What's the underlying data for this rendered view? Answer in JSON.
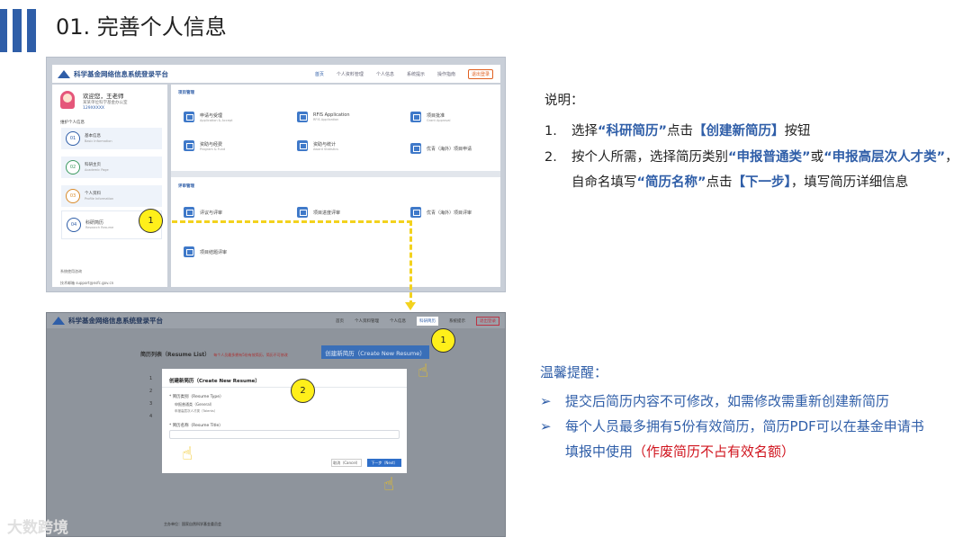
{
  "slide": {
    "title": "01. 完善个人信息"
  },
  "shot1": {
    "platform": "科学基金网络信息系统登录平台",
    "nav": [
      "首页",
      "个人资料管理",
      "个人信息",
      "系统提示",
      "操作指南"
    ],
    "logout": "退出登录",
    "welcome": "欢迎您，王老师",
    "org": "某某单位科学基金办公室",
    "id": "129XXXXX",
    "section": "维护个人信息",
    "menu": [
      {
        "num": "01",
        "label": "基本信息",
        "sub": "Basic Information"
      },
      {
        "num": "02",
        "label": "科研主页",
        "sub": "Academic Page"
      },
      {
        "num": "03",
        "label": "个人资料",
        "sub": "Profile Information"
      },
      {
        "num": "04",
        "label": "科研简历",
        "sub": "Research Resume"
      }
    ],
    "contact": "系统使用咨询",
    "contact_mail": "技术邮箱 support@nsfc.gov.cn",
    "group1": "项目管理",
    "group2": "评审管理",
    "cards": [
      {
        "label": "申请与受理",
        "sub": "Application & Accept"
      },
      {
        "label": "RFIS Application",
        "sub": "RFIS Application"
      },
      {
        "label": "项目批准",
        "sub": "Grant Approval"
      },
      {
        "label": "资助与经费",
        "sub": "Program & Fund"
      },
      {
        "label": "资助与统计",
        "sub": "Award Statistics"
      },
      {
        "label": "优青（海外）项目申请",
        "sub": ""
      },
      {
        "label": "评议与评审",
        "sub": ""
      },
      {
        "label": "项目进度评审",
        "sub": ""
      },
      {
        "label": "优青（海外）项目评审",
        "sub": ""
      },
      {
        "label": "项目结题评审",
        "sub": ""
      }
    ]
  },
  "badges": {
    "one": "1",
    "two": "2"
  },
  "shot2": {
    "nav": [
      "首页",
      "个人资料管理",
      "个人信息",
      "科研简历",
      "系统提示"
    ],
    "logout": "退出登录",
    "list_title": "简历列表（Resume List）",
    "list_note": "每个人员最多拥有5份有效简历，简历不可修改",
    "create_btn": "创建新简历（Create New Resume）",
    "rows": [
      "1",
      "2",
      "3",
      "4"
    ],
    "modal_title": "创建新简历（Create New Resume）",
    "field1": "* 简历类别（Resume Type）",
    "opt1": "申报普通类（General）",
    "opt2": "申报高层次人才类（Talents）",
    "field2": "* 简历名称（Resume Title）",
    "cancel": "取消（Cancel）",
    "next": "下一步（Next）",
    "footer": "主办单位：国家自然科学基金委员会"
  },
  "notes": {
    "head": "说明：",
    "step1": {
      "n": "1.",
      "pre": "选择",
      "kw1": "“科研简历”",
      "mid": "点击",
      "kw2": "【创建新简历】",
      "post": "按钮"
    },
    "step2": {
      "n": "2.",
      "a": "按个人所需，选择简历类别",
      "kw1": "“申报普通类”",
      "b": "或",
      "kw2": "“申报高层次人才类”",
      "c": "，自命名填写",
      "kw3": "“简历名称”",
      "d": "点击",
      "kw4": "【下一步】",
      "e": "，填写简历详细信息"
    }
  },
  "tips": {
    "head": "温馨提醒：",
    "t1": "提交后简历内容不可修改，如需修改需重新创建新简历",
    "t2a": "每个人员最多拥有5份有效简历，简历PDF可以在基金申请书填报中使用",
    "t2red": "（作废简历不占有效名额）"
  },
  "watermark": "大数跨境"
}
